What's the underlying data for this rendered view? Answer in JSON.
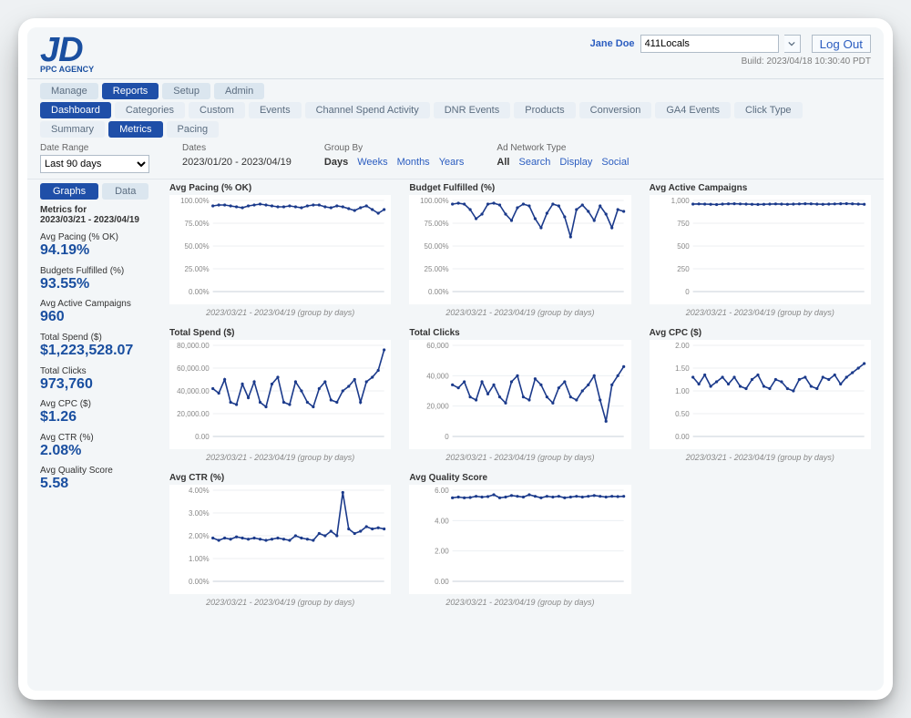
{
  "header": {
    "logo_main": "JD",
    "logo_sub": "PPC AGENCY",
    "user_name": "Jane Doe",
    "account_select": "411Locals",
    "logout_label": "Log Out",
    "build_stamp": "Build: 2023/04/18 10:30:40 PDT"
  },
  "nav1": {
    "items": [
      "Manage",
      "Reports",
      "Setup",
      "Admin"
    ],
    "active_index": 1
  },
  "nav2": {
    "items": [
      "Dashboard",
      "Categories",
      "Custom",
      "Events",
      "Channel Spend Activity",
      "DNR Events",
      "Products",
      "Conversion",
      "GA4 Events",
      "Click Type"
    ],
    "active_index": 0
  },
  "nav3": {
    "items": [
      "Summary",
      "Metrics",
      "Pacing"
    ],
    "active_index": 1
  },
  "filters": {
    "date_range_label": "Date Range",
    "date_range_value": "Last 90 days",
    "dates_label": "Dates",
    "dates_value": "2023/01/20 - 2023/04/19",
    "group_by_label": "Group By",
    "group_by_options": [
      "Days",
      "Weeks",
      "Months",
      "Years"
    ],
    "group_by_selected": 0,
    "ad_network_label": "Ad Network Type",
    "ad_network_options": [
      "All",
      "Search",
      "Display",
      "Social"
    ],
    "ad_network_selected": 0
  },
  "side_tabs": {
    "items": [
      "Graphs",
      "Data"
    ],
    "active_index": 0
  },
  "metrics_panel": {
    "title": "Metrics for",
    "range": "2023/03/21 - 2023/04/19",
    "items": [
      {
        "label": "Avg Pacing (% OK)",
        "value": "94.19%"
      },
      {
        "label": "Budgets Fulfilled (%)",
        "value": "93.55%"
      },
      {
        "label": "Avg Active Campaigns",
        "value": "960"
      },
      {
        "label": "Total Spend ($)",
        "value": "$1,223,528.07"
      },
      {
        "label": "Total Clicks",
        "value": "973,760"
      },
      {
        "label": "Avg CPC ($)",
        "value": "$1.26"
      },
      {
        "label": "Avg CTR (%)",
        "value": "2.08%"
      },
      {
        "label": "Avg Quality Score",
        "value": "5.58"
      }
    ]
  },
  "chart_caption": "2023/03/21 - 2023/04/19 (group by days)",
  "chart_data": [
    {
      "type": "line",
      "title": "Avg Pacing (% OK)",
      "ylim": [
        0,
        100
      ],
      "yticks": [
        0,
        25,
        50,
        75,
        100
      ],
      "yfmt": "pct2",
      "values": [
        94,
        95,
        95,
        94,
        93,
        92,
        94,
        95,
        96,
        95,
        94,
        93,
        93,
        94,
        93,
        92,
        94,
        95,
        95,
        93,
        92,
        94,
        93,
        91,
        89,
        92,
        94,
        90,
        86,
        90
      ]
    },
    {
      "type": "line",
      "title": "Budget Fulfilled (%)",
      "ylim": [
        0,
        100
      ],
      "yticks": [
        0,
        25,
        50,
        75,
        100
      ],
      "yfmt": "pct2",
      "values": [
        96,
        97,
        96,
        90,
        80,
        85,
        96,
        97,
        95,
        85,
        78,
        92,
        96,
        94,
        80,
        70,
        86,
        96,
        94,
        82,
        60,
        90,
        95,
        88,
        78,
        94,
        85,
        70,
        90,
        88
      ]
    },
    {
      "type": "line",
      "title": "Avg Active Campaigns",
      "ylim": [
        0,
        1000
      ],
      "yticks": [
        0,
        250,
        500,
        750,
        1000
      ],
      "yfmt": "int",
      "values": [
        960,
        962,
        960,
        958,
        955,
        960,
        963,
        964,
        962,
        960,
        958,
        956,
        958,
        960,
        962,
        960,
        958,
        960,
        962,
        964,
        963,
        960,
        958,
        960,
        962,
        964,
        965,
        963,
        960,
        958
      ]
    },
    {
      "type": "line",
      "title": "Total Spend ($)",
      "ylim": [
        0,
        80000
      ],
      "yticks": [
        0,
        20000,
        40000,
        60000,
        80000
      ],
      "yfmt": "money0",
      "values": [
        42000,
        38000,
        50000,
        30000,
        28000,
        46000,
        34000,
        48000,
        30000,
        26000,
        46000,
        52000,
        30000,
        28000,
        48000,
        40000,
        30000,
        26000,
        42000,
        48000,
        32000,
        30000,
        40000,
        44000,
        50000,
        30000,
        48000,
        52000,
        58000,
        76000
      ]
    },
    {
      "type": "line",
      "title": "Total Clicks",
      "ylim": [
        0,
        60000
      ],
      "yticks": [
        0,
        20000,
        40000,
        60000
      ],
      "yfmt": "int",
      "values": [
        34000,
        32000,
        36000,
        26000,
        24000,
        36000,
        28000,
        34000,
        26000,
        22000,
        36000,
        40000,
        26000,
        24000,
        38000,
        34000,
        26000,
        22000,
        32000,
        36000,
        26000,
        24000,
        30000,
        34000,
        40000,
        24000,
        10000,
        34000,
        40000,
        46000
      ]
    },
    {
      "type": "line",
      "title": "Avg CPC ($)",
      "ylim": [
        0,
        2
      ],
      "yticks": [
        0,
        0.5,
        1,
        1.5,
        2
      ],
      "yfmt": "dec2",
      "values": [
        1.3,
        1.15,
        1.35,
        1.1,
        1.2,
        1.3,
        1.15,
        1.3,
        1.1,
        1.05,
        1.25,
        1.35,
        1.1,
        1.05,
        1.25,
        1.2,
        1.05,
        1.0,
        1.25,
        1.3,
        1.1,
        1.05,
        1.3,
        1.25,
        1.35,
        1.15,
        1.3,
        1.4,
        1.5,
        1.6
      ]
    },
    {
      "type": "line",
      "title": "Avg CTR (%)",
      "ylim": [
        0,
        4
      ],
      "yticks": [
        0,
        1,
        2,
        3,
        4
      ],
      "yfmt": "pct2",
      "values": [
        1.9,
        1.8,
        1.9,
        1.85,
        1.95,
        1.9,
        1.85,
        1.9,
        1.85,
        1.8,
        1.85,
        1.9,
        1.85,
        1.8,
        2.0,
        1.9,
        1.85,
        1.8,
        2.1,
        2.0,
        2.2,
        2.0,
        3.9,
        2.3,
        2.1,
        2.2,
        2.4,
        2.3,
        2.35,
        2.3
      ]
    },
    {
      "type": "line",
      "title": "Avg Quality Score",
      "ylim": [
        0,
        6
      ],
      "yticks": [
        0,
        2,
        4,
        6
      ],
      "yfmt": "dec2",
      "values": [
        5.5,
        5.55,
        5.5,
        5.52,
        5.6,
        5.55,
        5.58,
        5.7,
        5.5,
        5.55,
        5.65,
        5.6,
        5.55,
        5.7,
        5.6,
        5.5,
        5.6,
        5.55,
        5.6,
        5.5,
        5.55,
        5.6,
        5.55,
        5.6,
        5.65,
        5.6,
        5.55,
        5.6,
        5.58,
        5.6
      ]
    }
  ]
}
